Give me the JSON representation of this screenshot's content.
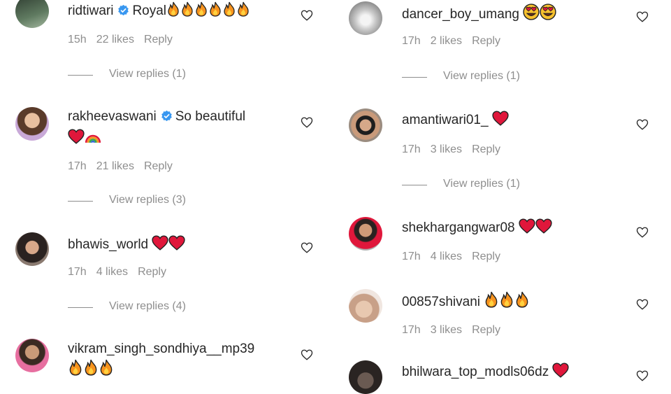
{
  "comments_left": [
    {
      "username": "ridtiwari",
      "verified": true,
      "text": "Royal",
      "emoji": [
        "fire",
        "fire",
        "fire",
        "fire",
        "fire",
        "fire"
      ],
      "time": "15h",
      "likes": "22 likes",
      "reply": "Reply",
      "view_replies": "View replies (1)"
    },
    {
      "username": "rakheevaswani",
      "verified": true,
      "text": "So beautiful",
      "emoji_line2": [
        "heart",
        "rainbow"
      ],
      "time": "17h",
      "likes": "21 likes",
      "reply": "Reply",
      "view_replies": "View replies (3)"
    },
    {
      "username": "bhawis_world",
      "verified": false,
      "text": "",
      "emoji": [
        "heart",
        "heart"
      ],
      "time": "17h",
      "likes": "4 likes",
      "reply": "Reply",
      "view_replies": "View replies (4)"
    },
    {
      "username": "vikram_singh_sondhiya__mp39",
      "verified": false,
      "text": "",
      "emoji_line2": [
        "fire",
        "fire",
        "fire"
      ]
    }
  ],
  "comments_right": [
    {
      "username": "dancer_boy_umang",
      "verified": false,
      "text": "",
      "emoji": [
        "heart-eyes",
        "heart-eyes"
      ],
      "time": "17h",
      "likes": "2 likes",
      "reply": "Reply",
      "view_replies": "View replies (1)"
    },
    {
      "username": "amantiwari01_",
      "verified": false,
      "text": "",
      "emoji": [
        "heart"
      ],
      "time": "17h",
      "likes": "3 likes",
      "reply": "Reply",
      "view_replies": "View replies (1)"
    },
    {
      "username": "shekhargangwar08",
      "verified": false,
      "text": "",
      "emoji": [
        "heart",
        "heart"
      ],
      "time": "17h",
      "likes": "4 likes",
      "reply": "Reply"
    },
    {
      "username": "00857shivani",
      "verified": false,
      "text": "",
      "emoji": [
        "fire",
        "fire",
        "fire"
      ],
      "time": "17h",
      "likes": "3 likes",
      "reply": "Reply"
    },
    {
      "username": "bhilwara_top_modls06dz",
      "verified": false,
      "text": "",
      "emoji": [
        "heart"
      ]
    }
  ],
  "colors": {
    "text": "#262626",
    "meta": "#8e8e8e",
    "verified": "#3897f0",
    "heart": "#e0173b",
    "fire": "#f7931e"
  },
  "icons": {
    "like": "heart-outline-icon",
    "verified": "verified-badge-icon"
  }
}
